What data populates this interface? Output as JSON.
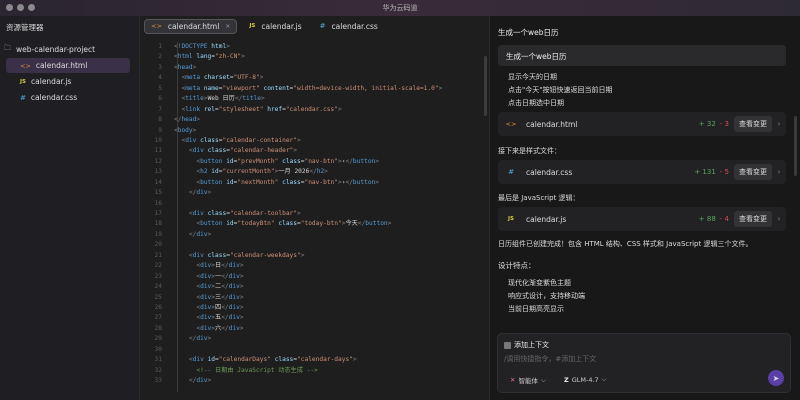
{
  "app": {
    "title": "华为云码道"
  },
  "sidebar": {
    "header": "资源管理器",
    "project": "web-calendar-project",
    "files": [
      {
        "name": "calendar.html",
        "icon": "<>"
      },
      {
        "name": "calendar.js",
        "icon": "JS"
      },
      {
        "name": "calendar.css",
        "icon": "#"
      }
    ]
  },
  "tabs": [
    {
      "label": "calendar.html",
      "icon": "<>",
      "close": "×"
    },
    {
      "label": "calendar.js",
      "icon": "JS"
    },
    {
      "label": "calendar.css",
      "icon": "#"
    }
  ],
  "code": [
    "<!DOCTYPE html>",
    "<html lang=\"zh-CN\">",
    "<head>",
    "  <meta charset=\"UTF-8\">",
    "  <meta name=\"viewport\" content=\"width=device-width, initial-scale=1.0\">",
    "  <title>Web 日历</title>",
    "  <link rel=\"stylesheet\" href=\"calendar.css\">",
    "</head>",
    "<body>",
    "  <div class=\"calendar-container\">",
    "    <div class=\"calendar-header\">",
    "      <button id=\"prevMonth\" class=\"nav-btn\">‹</button>",
    "      <h2 id=\"currentMonth\">一月 2026</h2>",
    "      <button id=\"nextMonth\" class=\"nav-btn\">›</button>",
    "    </div>",
    "",
    "    <div class=\"calendar-toolbar\">",
    "      <button id=\"todayBtn\" class=\"today-btn\">今天</button>",
    "    </div>",
    "",
    "    <div class=\"calendar-weekdays\">",
    "      <div>日</div>",
    "      <div>一</div>",
    "      <div>二</div>",
    "      <div>三</div>",
    "      <div>四</div>",
    "      <div>五</div>",
    "      <div>六</div>",
    "    </div>",
    "",
    "    <div id=\"calendarDays\" class=\"calendar-days\">",
    "      <!-- 日期由 JavaScript 动态生成 -->",
    "    </div>"
  ],
  "chat": {
    "title": "生成一个web日历",
    "user_message": "生成一个web日历",
    "list1": [
      "显示今天的日期",
      "点击\"今天\"按钮快速返回当前日期",
      "点击日期选中日期"
    ],
    "cards": [
      {
        "file": "calendar.html",
        "icon": "<>",
        "added": "+ 32",
        "removed": "- 3",
        "button": "查看变更"
      },
      {
        "file": "calendar.css",
        "icon": "#",
        "added": "+ 131",
        "removed": "- 5",
        "button": "查看变更"
      },
      {
        "file": "calendar.js",
        "icon": "JS",
        "added": "+ 88",
        "removed": "- 4",
        "button": "查看变更"
      }
    ],
    "intro_css": "接下来是样式文件：",
    "intro_js": "最后是 JavaScript 逻辑：",
    "summary": "日历组件已创建完成！包含 HTML 结构、CSS 样式和 JavaScript 逻辑三个文件。",
    "features_title": "设计特点：",
    "features": [
      "现代化渐变紫色主题",
      "响应式设计，支持移动端",
      "当前日期高亮显示"
    ]
  },
  "input": {
    "context_label": "添加上下文",
    "placeholder": "/调用快捷指令，#添加上下文",
    "agent": "智能体",
    "model": "GLM-4.7",
    "chevron": "⌵",
    "send_icon": "➤"
  }
}
